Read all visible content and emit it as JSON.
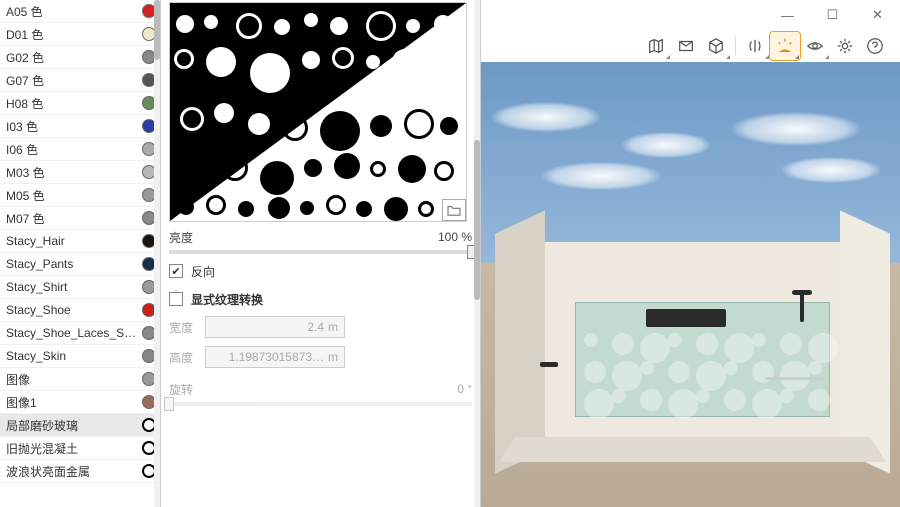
{
  "materials": [
    {
      "label": "A05 色",
      "color": "#d42020"
    },
    {
      "label": "D01 色",
      "color": "#f0e8c8"
    },
    {
      "label": "G02 色",
      "color": "#888888"
    },
    {
      "label": "G07 色",
      "color": "#555555"
    },
    {
      "label": "H08 色",
      "color": "#6a8a5a"
    },
    {
      "label": "I03 色",
      "color": "#2a3da8"
    },
    {
      "label": "I06 色",
      "color": "#aaaaaa"
    },
    {
      "label": "M03 色",
      "color": "#b8b8b8"
    },
    {
      "label": "M05 色",
      "color": "#9a9a9a"
    },
    {
      "label": "M07 色",
      "color": "#888888"
    },
    {
      "label": "Stacy_Hair",
      "color": "#1a1410"
    },
    {
      "label": "Stacy_Pants",
      "color": "#1a2a4a"
    },
    {
      "label": "Stacy_Shirt",
      "color": "#999999"
    },
    {
      "label": "Stacy_Shoe",
      "color": "#c82020"
    },
    {
      "label": "Stacy_Shoe_Laces_S…",
      "color": "#888888"
    },
    {
      "label": "Stacy_Skin",
      "color": "#888888"
    },
    {
      "label": "图像",
      "color": "#999999"
    },
    {
      "label": "图像1",
      "color": "#9a6a5a"
    },
    {
      "label": "局部磨砂玻璃",
      "color": "ring",
      "selected": true
    },
    {
      "label": "旧抛光混凝土",
      "color": "ring"
    },
    {
      "label": "波浪状亮面金属",
      "color": "ring"
    }
  ],
  "props": {
    "brightness_label": "亮度",
    "brightness_value": "100 %",
    "invert_label": "反向",
    "invert_checked": true,
    "explicit_label": "显式纹理转换",
    "explicit_checked": false,
    "width_label": "宽度",
    "width_value": "2.4",
    "width_unit": "m",
    "height_label": "高度",
    "height_value": "1.19873015873…",
    "height_unit": "m",
    "rotate_label": "旋转",
    "rotate_value": "0 °"
  },
  "toolbar": {
    "items": [
      "map",
      "section",
      "box",
      "split",
      "mirror",
      "sun",
      "eye",
      "settings",
      "help"
    ]
  },
  "window": {
    "min": "—",
    "max": "☐",
    "close": "✕"
  }
}
